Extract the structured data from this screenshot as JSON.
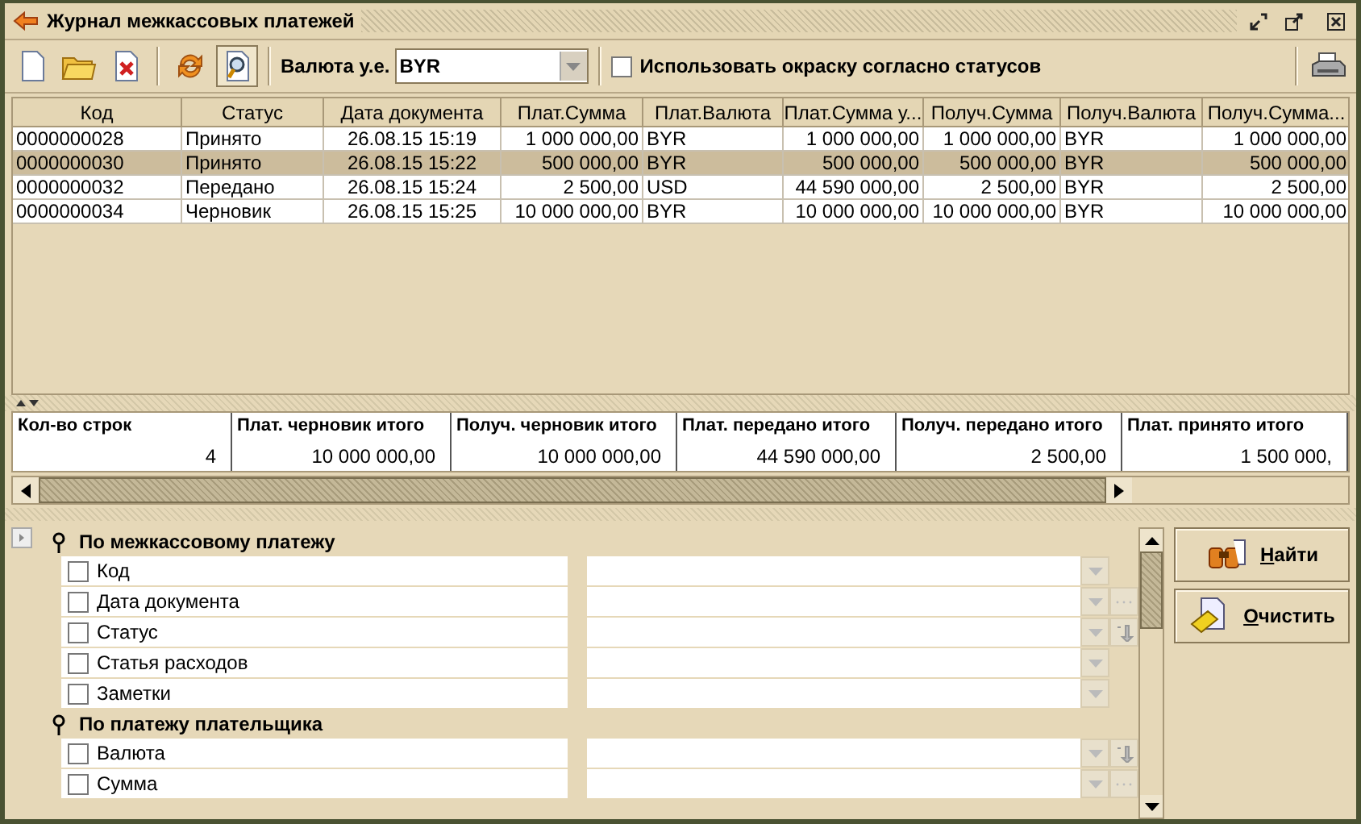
{
  "window": {
    "title": "Журнал межкассовых платежей"
  },
  "toolbar": {
    "currency_label": "Валюта у.е.",
    "currency_value": "BYR",
    "status_coloring": {
      "label": "Использовать окраску согласно статусов",
      "checked": false
    }
  },
  "table": {
    "columns": [
      {
        "label": "Код",
        "kind": "text"
      },
      {
        "label": "Статус",
        "kind": "text"
      },
      {
        "label": "Дата документа",
        "kind": "date"
      },
      {
        "label": "Плат.Сумма",
        "kind": "money"
      },
      {
        "label": "Плат.Валюта",
        "kind": "text"
      },
      {
        "label": "Плат.Сумма у...",
        "kind": "money"
      },
      {
        "label": "Получ.Сумма",
        "kind": "money"
      },
      {
        "label": "Получ.Валюта",
        "kind": "text"
      },
      {
        "label": "Получ.Сумма...",
        "kind": "money"
      }
    ],
    "rows": [
      {
        "selected": false,
        "cells": [
          "0000000028",
          "Принято",
          "26.08.15 15:19",
          "1 000 000,00",
          "BYR",
          "1 000 000,00",
          "1 000 000,00",
          "BYR",
          "1 000 000,00"
        ]
      },
      {
        "selected": true,
        "cells": [
          "0000000030",
          "Принято",
          "26.08.15 15:22",
          "500 000,00",
          "BYR",
          "500 000,00",
          "500 000,00",
          "BYR",
          "500 000,00"
        ]
      },
      {
        "selected": false,
        "cells": [
          "0000000032",
          "Передано",
          "26.08.15 15:24",
          "2 500,00",
          "USD",
          "44 590 000,00",
          "2 500,00",
          "BYR",
          "2 500,00"
        ]
      },
      {
        "selected": false,
        "cells": [
          "0000000034",
          "Черновик",
          "26.08.15 15:25",
          "10 000 000,00",
          "BYR",
          "10 000 000,00",
          "10 000 000,00",
          "BYR",
          "10 000 000,00"
        ]
      }
    ]
  },
  "totals": [
    {
      "label": "Кол-во строк",
      "value": "4"
    },
    {
      "label": "Плат. черновик итого",
      "value": "10 000 000,00"
    },
    {
      "label": "Получ. черновик итого",
      "value": "10 000 000,00"
    },
    {
      "label": "Плат. передано итого",
      "value": "44 590 000,00"
    },
    {
      "label": "Получ. передано итого",
      "value": "2 500,00"
    },
    {
      "label": "Плат. принято итого",
      "value": "1 500 000,"
    }
  ],
  "filters": [
    {
      "title": "По межкассовому платежу",
      "fields": [
        {
          "label": "Код",
          "checked": false,
          "kind": "dropdown"
        },
        {
          "label": "Дата документа",
          "checked": false,
          "kind": "date"
        },
        {
          "label": "Статус",
          "checked": false,
          "kind": "picker"
        },
        {
          "label": "Статья расходов",
          "checked": false,
          "kind": "dropdown"
        },
        {
          "label": "Заметки",
          "checked": false,
          "kind": "dropdown"
        }
      ]
    },
    {
      "title": "По платежу плательщика",
      "fields": [
        {
          "label": "Валюта",
          "checked": false,
          "kind": "picker"
        },
        {
          "label": "Сумма",
          "checked": false,
          "kind": "date"
        }
      ]
    }
  ],
  "actions": [
    {
      "label": "Найти",
      "kind": "find"
    },
    {
      "label": "Очистить",
      "kind": "clear"
    }
  ]
}
